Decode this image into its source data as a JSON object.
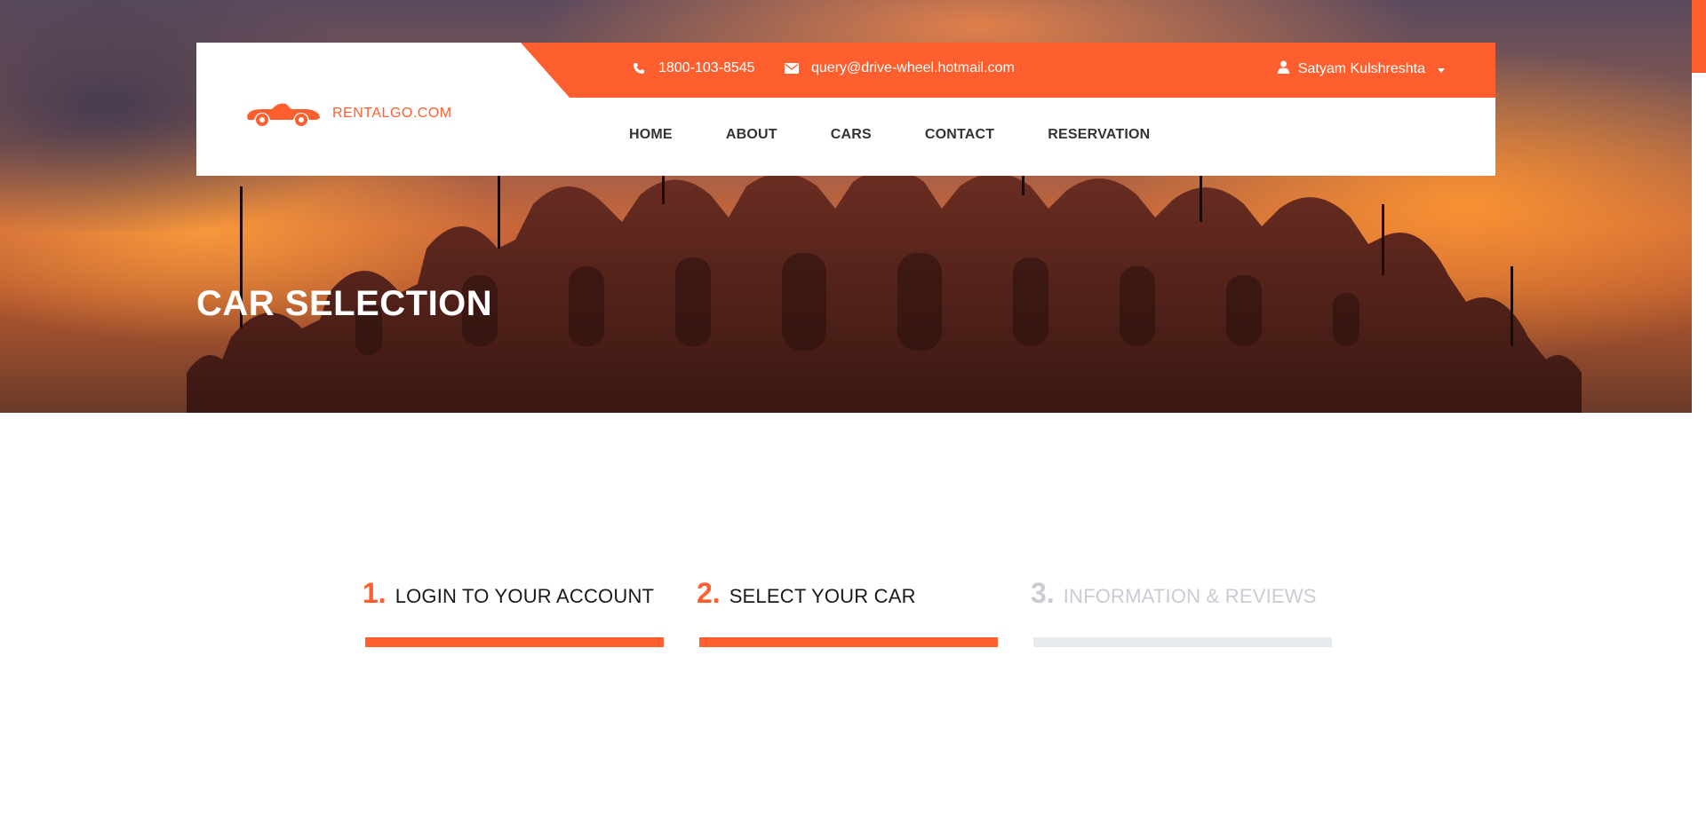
{
  "brand": {
    "logo_text": "RENTALGO.COM",
    "accent": "#ff5f2e"
  },
  "topbar": {
    "phone": "1800-103-8545",
    "email": "query@drive-wheel.hotmail.com",
    "user_name": "Satyam Kulshreshta",
    "icons": {
      "phone": "phone-icon",
      "email": "envelope-icon",
      "user": "user-icon",
      "dropdown": "caret-down-icon"
    }
  },
  "nav": {
    "items": [
      {
        "label": "HOME"
      },
      {
        "label": "ABOUT"
      },
      {
        "label": "CARS"
      },
      {
        "label": "CONTACT"
      },
      {
        "label": "RESERVATION"
      }
    ]
  },
  "hero": {
    "title": "CAR SELECTION"
  },
  "steps": [
    {
      "number": "1.",
      "label": "LOGIN TO YOUR ACCOUNT",
      "state": "complete"
    },
    {
      "number": "2.",
      "label": "SELECT YOUR CAR",
      "state": "active"
    },
    {
      "number": "3.",
      "label": "INFORMATION & REVIEWS",
      "state": "inactive"
    }
  ]
}
